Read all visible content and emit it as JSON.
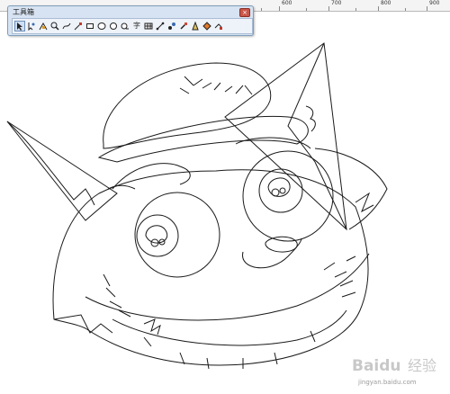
{
  "ruler": {
    "labels": [
      "600",
      "700",
      "800",
      "900"
    ]
  },
  "toolbox": {
    "title": "工具箱",
    "close_glyph": "×",
    "text_tool_glyph": "字",
    "tools": [
      "pick-tool",
      "shape-tool",
      "smart-fill-tool",
      "zoom-tool",
      "freehand-tool",
      "smart-drawing-tool",
      "rectangle-tool",
      "ellipse-tool",
      "polygon-tool",
      "basic-shapes-tool",
      "text-tool",
      "table-tool",
      "connector-tool",
      "blend-tool",
      "eyedropper-tool",
      "outline-tool",
      "fill-tool",
      "interactive-fill-tool"
    ]
  },
  "watermark": {
    "brand": "Baidu",
    "product": "经验",
    "url": "jingyan.baidu.com"
  },
  "colors": {
    "ruler_bg": "#f4f4f4",
    "toolbox_bg": "#d7e3f2",
    "stroke": "#1a1a1a",
    "watermark": "#c8c8c8"
  }
}
